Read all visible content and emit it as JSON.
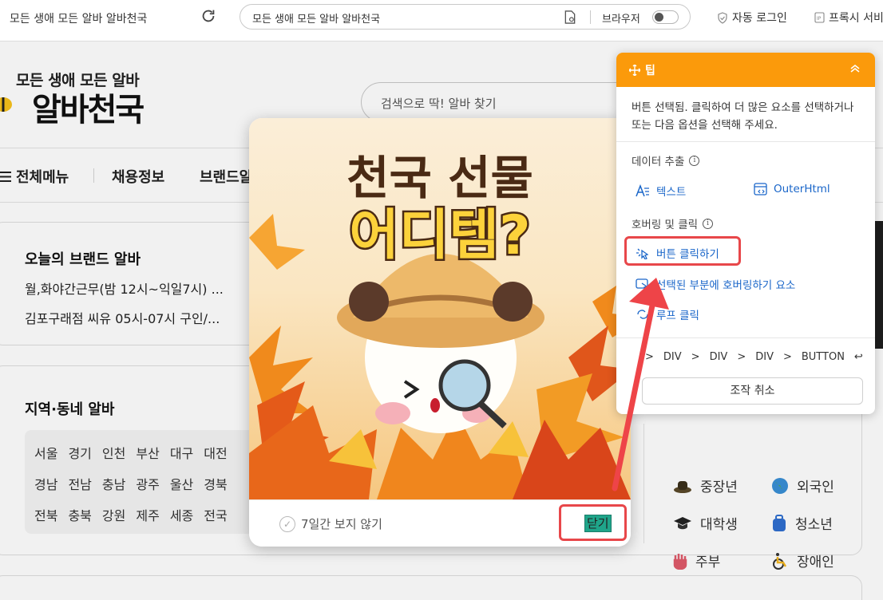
{
  "toolbar": {
    "page_title": "모든 생애 모든 알바 알바천국",
    "url_text": "모든 생애 모든 알바 알바천국",
    "browser_label": "브라우저",
    "auto_login_label": "자동 로그인",
    "proxy_label": "프록시 서비"
  },
  "site": {
    "logo_tagline": "모든 생애 모든 알바",
    "logo_name": "알바천국",
    "search_placeholder": "검색으로 딱! 알바 찾기",
    "nav": {
      "all_menu": "전체메뉴",
      "jobs": "채용정보",
      "brand": "브랜드알"
    },
    "brand_section": {
      "title": "오늘의 브랜드 알바",
      "lines": [
        "월,화야간근무(밤 12시~익일7시) ...",
        "김포구래점 씨유 05시-07시 구인/..."
      ]
    },
    "region_section": {
      "title": "지역·동네 알바",
      "rows": [
        [
          "서울",
          "경기",
          "인천",
          "부산",
          "대구",
          "대전"
        ],
        [
          "경남",
          "전남",
          "충남",
          "광주",
          "울산",
          "경북"
        ],
        [
          "전북",
          "충북",
          "강원",
          "제주",
          "세종",
          "전국"
        ]
      ]
    },
    "categories": {
      "middle_aged": "중장년",
      "foreigner": "외국인",
      "student": "대학생",
      "teen": "청소년",
      "homemaker": "주부",
      "disabled": "장애인"
    }
  },
  "popup": {
    "headline_1": "천국 선물",
    "headline_2": "어디템?",
    "dont_show_label": "7일간 보지 않기",
    "close_label": "닫기"
  },
  "tip_panel": {
    "title": "팁",
    "description": "버튼 선택됨. 클릭하여 더 많은 요소를 선택하거나 또는 다음 옵션을 선택해 주세요.",
    "data_extract_label": "데이터 추출",
    "text_action": "텍스트",
    "outer_html_action": "OuterHtml",
    "hover_click_label": "호버링 및 클릭",
    "click_button_action": "버튼 클릭하기",
    "hover_action": "선택된 부분에 호버링하기 요소",
    "loop_click_action": "루프 클릭",
    "breadcrumb": [
      "DIV",
      "DIV",
      "DIV",
      "BUTTON"
    ],
    "undo_label": "조작 취소"
  },
  "colors": {
    "tip_header": "#fb9a0b",
    "highlight_red": "#e8474a",
    "link_blue": "#1a66c9",
    "close_selected": "#1fa58a"
  }
}
